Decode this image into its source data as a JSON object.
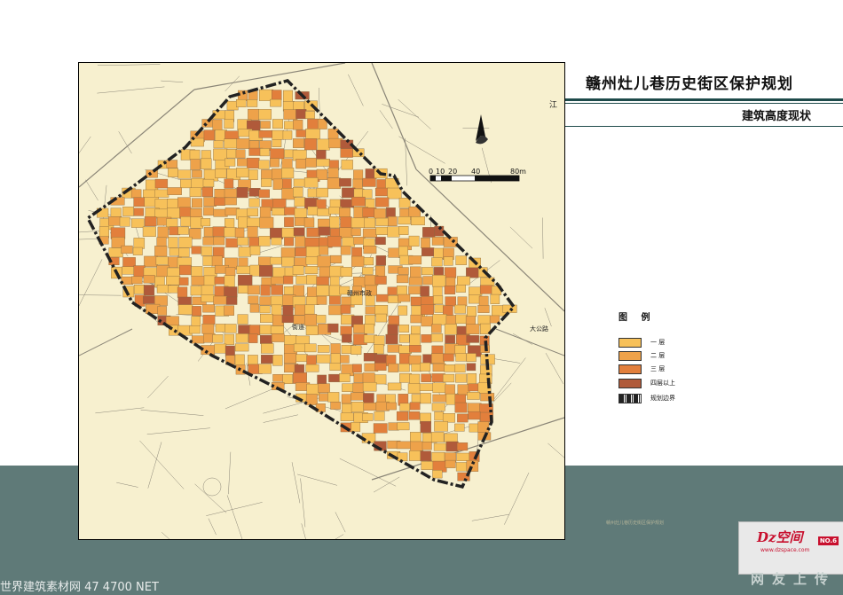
{
  "title": "赣州灶儿巷历史街区保护规划",
  "subtitle": "建筑高度现状",
  "scale_bar": {
    "ticks": [
      "0",
      "10",
      "20",
      "40",
      "80m"
    ]
  },
  "map_labels": [
    "赣州市政",
    "大公路",
    "街道",
    "江"
  ],
  "legend": {
    "title": "图 例",
    "items": [
      {
        "label": "一 层",
        "color": "#f7c15a"
      },
      {
        "label": "二 层",
        "color": "#eea24a"
      },
      {
        "label": "三 层",
        "color": "#e27f3c"
      },
      {
        "label": "四层以上",
        "color": "#b05a3a"
      },
      {
        "label": "规划边界",
        "color": "#222222",
        "pattern": "dash-dot-boundary"
      }
    ]
  },
  "colors": {
    "map_background": "#f7f0cf",
    "band": "#5f7a78",
    "accent_rule": "#1e4a4a",
    "logo_red": "#c8102e"
  },
  "logo": {
    "text": "Dz空间",
    "badge": "NO.6",
    "url": "www.dzspace.com"
  },
  "upload_text": "网友上传",
  "watermark": "世界建筑素材网 47 4700 NET",
  "band_caption": "赣州灶儿巷历史街区保护规划"
}
